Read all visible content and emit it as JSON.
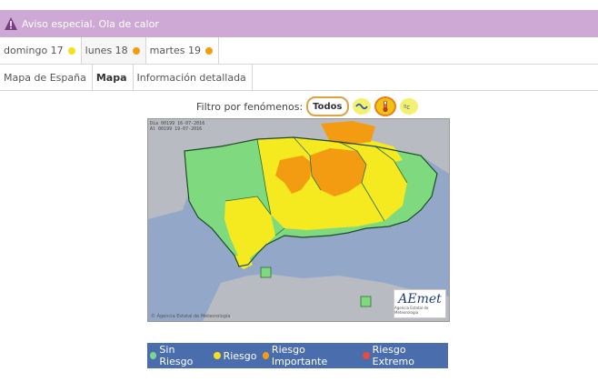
{
  "banner": {
    "text": "Aviso especial. Ola de calor",
    "icon": "warning-triangle-icon"
  },
  "days": [
    {
      "label": "domingo 17",
      "color": "#f5e11a"
    },
    {
      "label": "lunes 18",
      "color": "#f39c12"
    },
    {
      "label": "martes 19",
      "color": "#f39c12"
    }
  ],
  "tabs": [
    {
      "label": "Mapa de España"
    },
    {
      "label": "Mapa"
    },
    {
      "label": "Información detallada"
    }
  ],
  "filter": {
    "label": "Filtro por fenómenos:",
    "todos": "Todos"
  },
  "map": {
    "stamp_line1": "Día 00199 16-07-2016",
    "stamp_line2": "Al  00199 19-07-2016",
    "credit": "© Agencia Estatal de Meteorología",
    "logo_brand": "AEmet",
    "logo_sub": "Agencia Estatal de Meteorología"
  },
  "legend": [
    {
      "label": "Sin Riesgo",
      "color": "#7dd68d"
    },
    {
      "label": "Riesgo",
      "color": "#f5e11a"
    },
    {
      "label": "Riesgo Importante",
      "color": "#f39c12"
    },
    {
      "label": "Riesgo Extremo",
      "color": "#e74c3c"
    }
  ]
}
